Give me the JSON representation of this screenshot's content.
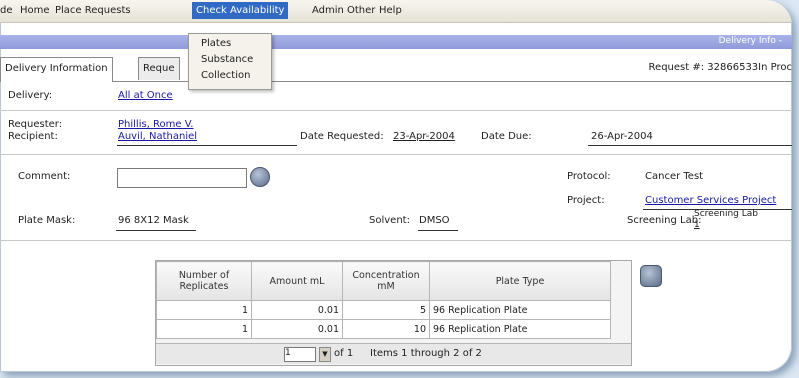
{
  "menu": {
    "items": [
      "de",
      "Home",
      "Place Requests",
      "Check Availability",
      "Admin",
      "Other",
      "Help"
    ]
  },
  "dropdown": {
    "items": [
      "Plates",
      "Substance",
      "Collection"
    ]
  },
  "titlebar": {
    "text": "Delivery Info - "
  },
  "tabs": [
    "Delivery Information",
    "Reque"
  ],
  "request_number": "Request #: 32866533In Proc",
  "delivery": {
    "label": "Delivery:",
    "value": "All at Once"
  },
  "requester": {
    "label": "Requester:",
    "value": "Phillis, Rome V."
  },
  "recipient": {
    "label": "Recipient:",
    "value": "Auvil, Nathaniel"
  },
  "date_requested": {
    "label": "Date Requested:",
    "value": "23-Apr-2004"
  },
  "date_due": {
    "label": "Date Due:",
    "value": "26-Apr-2004"
  },
  "comment": {
    "label": "Comment:",
    "value": ""
  },
  "protocol": {
    "label": "Protocol:",
    "value": "Cancer Test"
  },
  "project": {
    "label": "Project:",
    "value": "Customer Services Project"
  },
  "plate_mask": {
    "label": "Plate Mask:",
    "value": "96 8X12 Mask"
  },
  "solvent": {
    "label": "Solvent:",
    "value": "DMSO"
  },
  "screening_lab": {
    "label": "Screening Lab:",
    "value_line1": "Screening Lab",
    "value_line2": "1"
  },
  "table": {
    "headers": [
      "Number of Replicates",
      "Amount mL",
      "Concentration mM",
      "Plate Type"
    ],
    "rows": [
      [
        "1",
        "0.01",
        "5",
        "96 Replication Plate"
      ],
      [
        "1",
        "0.01",
        "10",
        "96 Replication Plate"
      ]
    ]
  },
  "pager": {
    "page": "1",
    "of_text": "of 1",
    "items_text": "Items 1 through 2 of 2"
  }
}
